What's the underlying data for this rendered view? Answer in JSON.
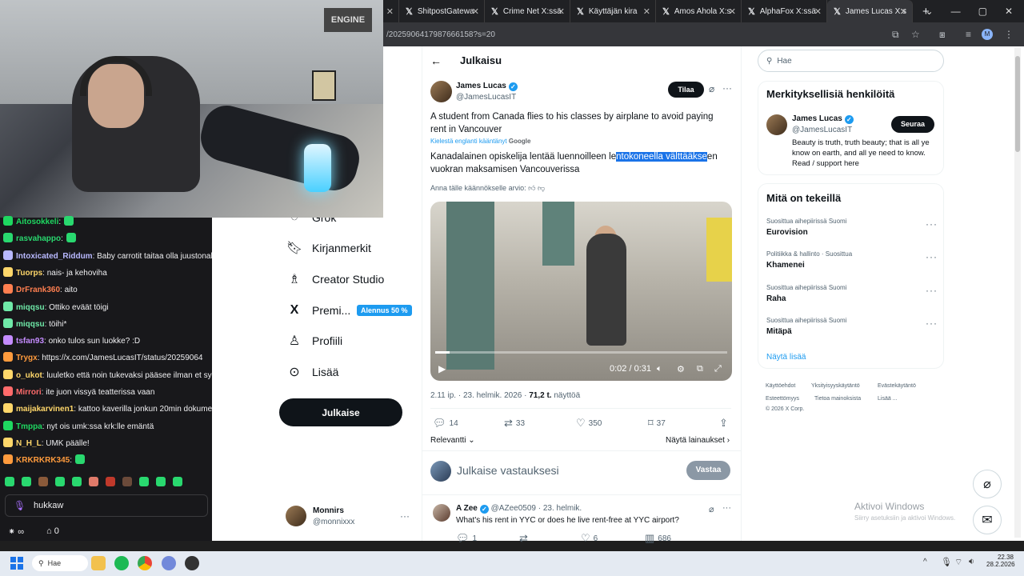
{
  "browser": {
    "tabs": [
      {
        "label": "ShitpostGatewa"
      },
      {
        "label": "Crime Net X:ssä"
      },
      {
        "label": "Käyttäjän kira"
      },
      {
        "label": "Amos Ahola X:s"
      },
      {
        "label": "AlphaFox X:ssä"
      },
      {
        "label": "James Lucas X:s",
        "active": true
      }
    ],
    "url": "/2025906417987666158?s=20",
    "new_tab": "+"
  },
  "stream": {
    "webcam_sign": "ENGINE",
    "chat": [
      {
        "user": "Aitosokkeli",
        "text": ":",
        "color": "#1ed760",
        "emote": true
      },
      {
        "user": "rasvahappo",
        "text": ":",
        "color": "#29d86f",
        "emote": true
      },
      {
        "user": "Intoxicated_Riddum",
        "text": ": Baby carrotit taitaa olla juustonaksuj",
        "color": "#b9b9ff"
      },
      {
        "user": "Tuorps",
        "text": ": nais- ja kehoviha",
        "color": "#ffd76a"
      },
      {
        "user": "DrFrank360",
        "text": ": aito",
        "color": "#ff7f50"
      },
      {
        "user": "miqqsu",
        "text": ": Ottiko eväät töigi",
        "color": "#6fe9a8"
      },
      {
        "user": "miqqsu",
        "text": ": töihi*",
        "color": "#6fe9a8"
      },
      {
        "user": "tsfan93",
        "text": ": onko tulos sun luokke? :D",
        "color": "#c58cff"
      },
      {
        "user": "Trygx",
        "text": ": https://x.com/JamesLucasIT/status/20259064",
        "color": "#ff9b3d"
      },
      {
        "user": "o_ukot",
        "text": ": luuletko että noin tukevaksi pääsee ilman et syö k",
        "color": "#ffd76a"
      },
      {
        "user": "Mirrori",
        "text": ": ite juon vissyä teatterissa vaan",
        "color": "#ff6b6b"
      },
      {
        "user": "maijakarvinen1",
        "text": ": kattoo kaverilla jonkun 20min dokumentin",
        "color": "#ffd76a"
      },
      {
        "user": "Tmppa",
        "text": ": nyt ois umk:ssa krk:lle emäntä",
        "color": "#1ed760"
      },
      {
        "user": "N_H_L",
        "text": ": UMK päälle!",
        "color": "#ffd76a"
      },
      {
        "user": "KRKRKRK345",
        "text": ":",
        "color": "#ff9b3d",
        "emote": true
      }
    ],
    "chat_input": "hukkaw",
    "viewers": "∞",
    "points": "0"
  },
  "nav": {
    "items": [
      {
        "label": "Grok",
        "icon": "grok-icon"
      },
      {
        "label": "Kirjanmerkit",
        "icon": "bookmark-icon"
      },
      {
        "label": "Creator Studio",
        "icon": "creator-studio-icon"
      },
      {
        "label": "Premi...",
        "icon": "x-logo-icon"
      },
      {
        "label": "Profiili",
        "icon": "profile-icon"
      },
      {
        "label": "Lisää",
        "icon": "more-circle-icon"
      }
    ],
    "premium_badge": "Alennus 50 %",
    "post_button": "Julkaise",
    "account": {
      "name": "Monnirs",
      "handle": "@monnixxx"
    }
  },
  "post": {
    "header_title": "Julkaisu",
    "author_name": "James Lucas",
    "author_handle": "@JamesLucasIT",
    "order_button": "Tilaa",
    "text_line1": "A student from Canada flies to his classes by airplane to avoid paying",
    "text_line2": "rent in Vancouver",
    "translated_by": "Kielestä englanti kääntänyt",
    "google": "Google",
    "translation_pre": "Kanadalainen opiskelija lentää luennoilleen le",
    "translation_sel": "ntokoneella välttääkse",
    "translation_post": "en",
    "translation_line2": "vuokran maksamisen Vancouverissa",
    "rate_prompt": "Anna tälle käännökselle arvio:",
    "video_time": "0:02 / 0:31",
    "meta_time": "2.11 ip. · 23. helmik. 2026 ·",
    "meta_views": "71,2 t.",
    "meta_views_label": "näyttöä",
    "replies": "14",
    "reposts": "33",
    "likes": "350",
    "bookmarks": "37",
    "relevance": "Relevantti",
    "show_quotes": "Näytä lainaukset",
    "reply_placeholder": "Julkaise vastauksesi",
    "reply_button": "Vastaa"
  },
  "reply": {
    "name": "A Zee",
    "handle": "@AZee0509 · 23. helmik.",
    "text": "What's his rent in YYC or does he live rent-free at YYC airport?",
    "replies": "1",
    "likes": "6",
    "views": "686"
  },
  "sidebar": {
    "search_placeholder": "Hae",
    "people_title": "Merkityksellisiä henkilöitä",
    "person_name": "James Lucas",
    "person_handle": "@JamesLucasIT",
    "follow_button": "Seuraa",
    "person_bio": "Beauty is truth, truth beauty; that is all ye know on earth, and all ye need to know. Read / support here",
    "trending_title": "Mitä on tekeillä",
    "trends": [
      {
        "context": "Suosittua aihepiirissä Suomi",
        "name": "Eurovision"
      },
      {
        "context": "Politiikka & hallinto · Suosittua",
        "name": "Khamenei"
      },
      {
        "context": "Suosittua aihepiirissä Suomi",
        "name": "Raha"
      },
      {
        "context": "Suosittua aihepiirissä Suomi",
        "name": "Mitäpä"
      }
    ],
    "show_more": "Näytä lisää",
    "footer": [
      "Käyttöehdot",
      "Yksityisyyskäytäntö",
      "Evästekäytäntö",
      "Esteettömyys",
      "Tietoa mainoksista",
      "Lisää ...",
      "© 2026 X Corp."
    ]
  },
  "windows": {
    "activate_title": "Aktivoi Windows",
    "activate_sub": "Siirry asetuksiin ja aktivoi Windows.",
    "search": "Hae",
    "time": "22.38",
    "date": "28.2.2026"
  }
}
